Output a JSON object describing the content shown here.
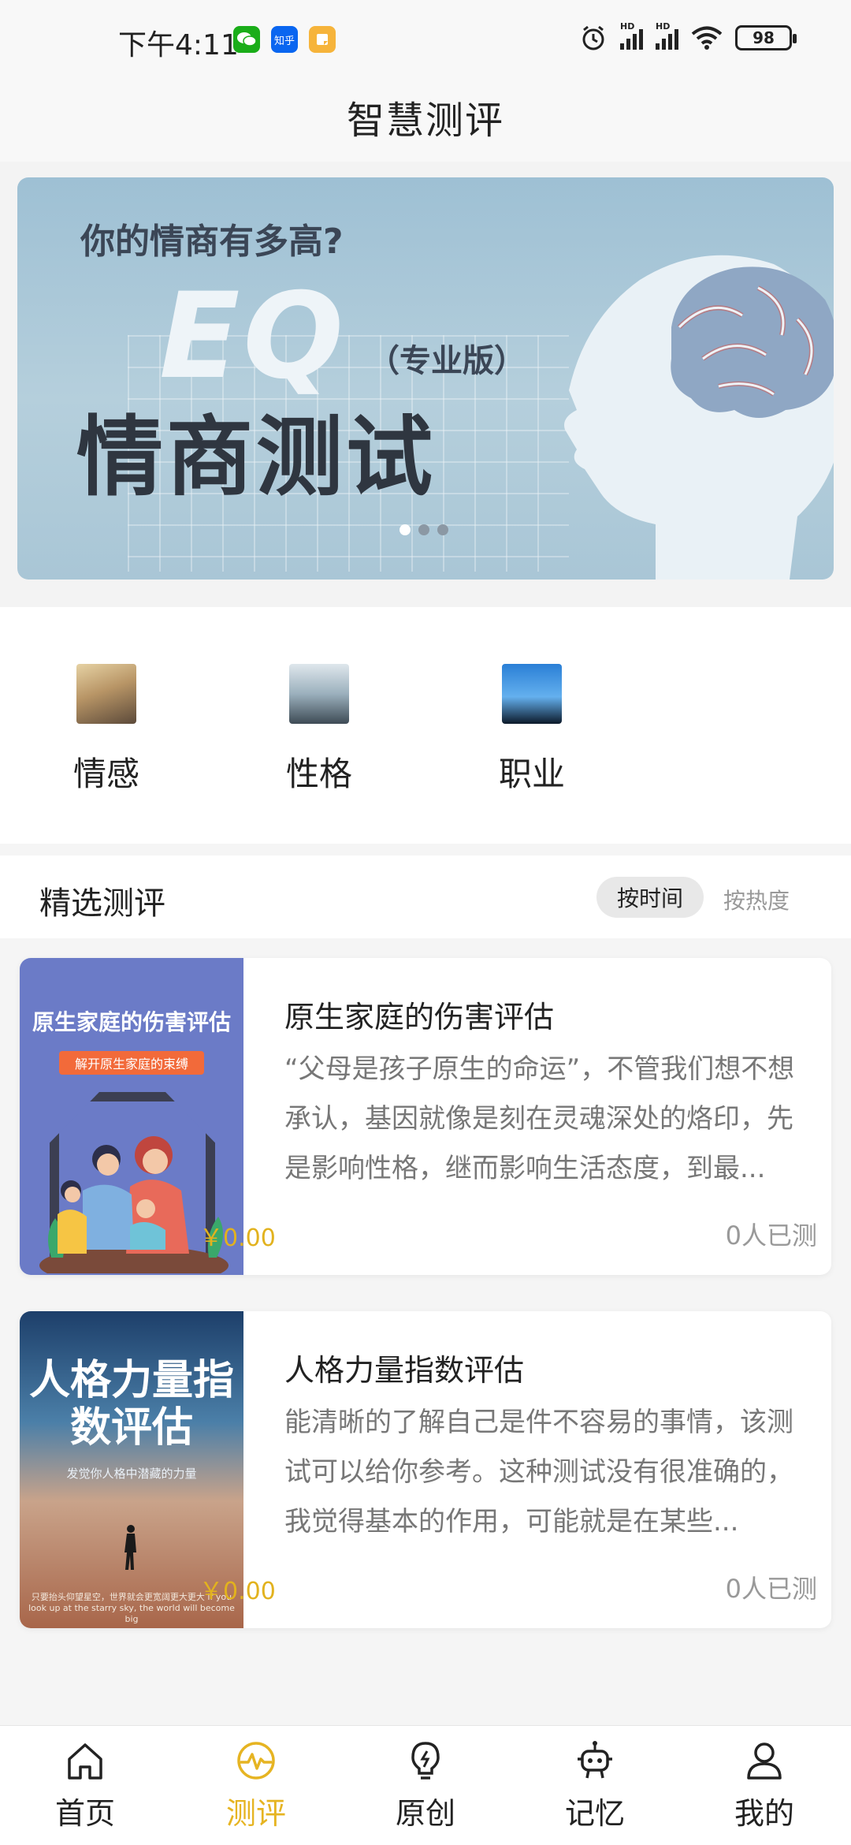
{
  "status_bar": {
    "time": "下午4:11",
    "app_icons": [
      "wechat-icon",
      "zhihu-icon",
      "notes-icon"
    ],
    "zhihu_label": "知乎",
    "signal_label_1": "HD",
    "signal_label_2": "HD",
    "battery": "98"
  },
  "header": {
    "title": "智慧测评"
  },
  "banner": {
    "question": "你的情商有多高?",
    "eq": "EQ",
    "edition": "（专业版）",
    "title": "情商测试",
    "dots_count": 3,
    "active_dot": 0
  },
  "categories": [
    {
      "label": "情感",
      "icon": "emotion-image"
    },
    {
      "label": "性格",
      "icon": "personality-image"
    },
    {
      "label": "职业",
      "icon": "career-image"
    }
  ],
  "featured": {
    "title": "精选测评",
    "sort_time": "按时间",
    "sort_hot": "按热度",
    "items": [
      {
        "title": "原生家庭的伤害评估",
        "description": "“父母是孩子原生的命运”，不管我们想不想承认，基因就像是刻在灵魂深处的烙印，先是影响性格，继而影响生活态度，到最...",
        "price": "￥0.00",
        "count": "0人已测",
        "cover_title": "原生家庭的伤害评估",
        "cover_subtitle": "解开原生家庭的束缚"
      },
      {
        "title": "人格力量指数评估",
        "description": "能清晰的了解自己是件不容易的事情，该测试可以给你参考。这种测试没有很准确的，我觉得基本的作用，可能就是在某些...",
        "price": "￥0.00",
        "count": "0人已测",
        "cover_title": "人格力量指数评估",
        "cover_subtitle": "发觉你人格中潜藏的力量",
        "cover_footer": "只要抬头仰望星空，世界就会更宽阔更大更大 if you look up at the starry sky, the world will become big"
      }
    ]
  },
  "bottom_nav": {
    "items": [
      {
        "label": "首页",
        "icon": "home-icon",
        "active": false
      },
      {
        "label": "测评",
        "icon": "pulse-icon",
        "active": true
      },
      {
        "label": "原创",
        "icon": "lightbulb-icon",
        "active": false
      },
      {
        "label": "记忆",
        "icon": "robot-icon",
        "active": false
      },
      {
        "label": "我的",
        "icon": "user-icon",
        "active": false
      }
    ]
  },
  "colors": {
    "accent": "#e6b422",
    "price": "#e2b21e"
  }
}
